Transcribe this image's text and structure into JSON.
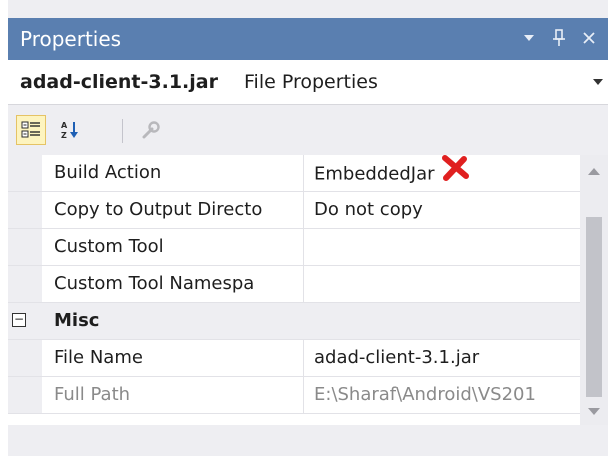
{
  "panel": {
    "title": "Properties",
    "title_buttons": [
      {
        "name": "window-position-icon",
        "glyph": "▾"
      },
      {
        "name": "pin-icon",
        "glyph": "ꟼ"
      },
      {
        "name": "close-icon",
        "glyph": "✕"
      }
    ]
  },
  "object_selector": {
    "name": "adad-client-3.1.jar",
    "type": "File Properties",
    "dropdown_glyph": "▾"
  },
  "toolbar": {
    "items": [
      {
        "name": "categorized-icon",
        "active": true
      },
      {
        "name": "alphabetical-icon",
        "active": false
      },
      {
        "name": "property-pages-icon",
        "active": false,
        "disabled": true
      }
    ]
  },
  "grid": {
    "rows": [
      {
        "kind": "property",
        "name": "Build Action",
        "value": "EmbeddedJar",
        "marked": true
      },
      {
        "kind": "property",
        "name": "Copy to Output Directo",
        "value": "Do not copy"
      },
      {
        "kind": "property",
        "name": "Custom Tool",
        "value": ""
      },
      {
        "kind": "property",
        "name": "Custom Tool Namespa",
        "value": ""
      },
      {
        "kind": "category",
        "name": "Misc",
        "expander": "−"
      },
      {
        "kind": "property",
        "name": "File Name",
        "value": "adad-client-3.1.jar"
      },
      {
        "kind": "property",
        "name": "Full Path",
        "value": "E:\\Sharaf\\Android\\VS201",
        "readonly": true
      }
    ]
  },
  "colors": {
    "titlebar": "#5a7fb0",
    "panel_bg": "#eeeef2",
    "active_tool_bg": "#fdf4bf",
    "marker_red": "#e02020",
    "readonly_text": "#8a8a8a"
  }
}
